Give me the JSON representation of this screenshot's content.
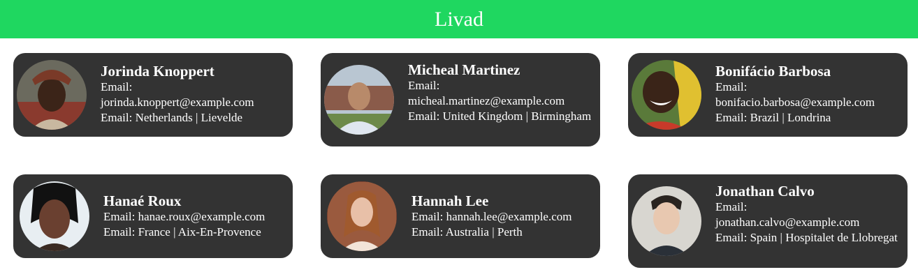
{
  "header": {
    "title": "Livad"
  },
  "users": [
    {
      "name": "Jorinda Knoppert",
      "email_label": "Email:",
      "email": "jorinda.knoppert@example.com",
      "location_label": "Email:",
      "location": "Netherlands | Lievelde",
      "avatar_icon": "person-photo-icon"
    },
    {
      "name": "Micheal Martinez",
      "email_label": "Email:",
      "email": "micheal.martinez@example.com",
      "location_label": "Email:",
      "location": "United Kingdom | Birmingham",
      "avatar_icon": "person-photo-icon"
    },
    {
      "name": "Bonifácio Barbosa",
      "email_label": "Email:",
      "email": "bonifacio.barbosa@example.com",
      "location_label": "Email:",
      "location": "Brazil | Londrina",
      "avatar_icon": "person-photo-icon"
    },
    {
      "name": "Hanaé Roux",
      "email_label": "Email:",
      "email": "hanae.roux@example.com",
      "location_label": "Email:",
      "location": "France | Aix-En-Provence",
      "avatar_icon": "person-photo-icon"
    },
    {
      "name": "Hannah Lee",
      "email_label": "Email:",
      "email": "hannah.lee@example.com",
      "location_label": "Email:",
      "location": "Australia | Perth",
      "avatar_icon": "person-photo-icon"
    },
    {
      "name": "Jonathan Calvo",
      "email_label": "Email:",
      "email": "jonathan.calvo@example.com",
      "location_label": "Email:",
      "location": "Spain | Hospitalet de Llobregat",
      "avatar_icon": "person-photo-icon"
    }
  ],
  "colors": {
    "header_bg": "#1fd760",
    "card_bg": "#333333",
    "text": "#ffffff"
  }
}
